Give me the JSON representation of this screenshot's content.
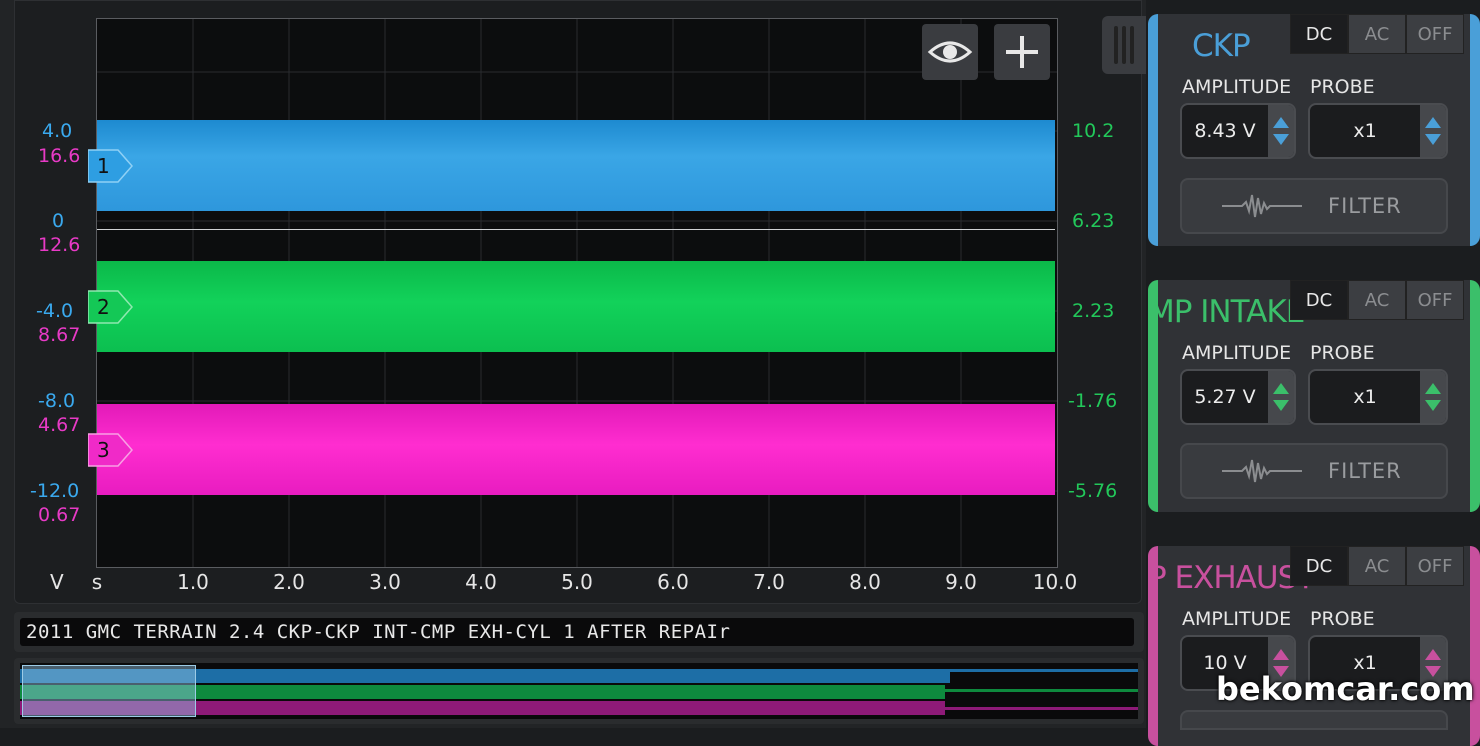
{
  "left_axis": {
    "unit": "V",
    "ticks": [
      {
        "blue": "4.0",
        "pink": "16.6"
      },
      {
        "blue": "0",
        "pink": "12.6"
      },
      {
        "blue": "-4.0",
        "pink": "8.67"
      },
      {
        "blue": "-8.0",
        "pink": "4.67"
      },
      {
        "blue": "-12.0",
        "pink": "0.67"
      }
    ]
  },
  "right_axis": {
    "ticks": [
      "10.2",
      "6.23",
      "2.23",
      "-1.76",
      "-5.76"
    ]
  },
  "x_axis": {
    "unit": "s",
    "ticks": [
      "1.0",
      "2.0",
      "3.0",
      "4.0",
      "5.0",
      "6.0",
      "7.0",
      "8.0",
      "9.0",
      "10.0"
    ]
  },
  "channels": [
    {
      "marker": "1",
      "color": "#2e97dc"
    },
    {
      "marker": "2",
      "color": "#12d25a"
    },
    {
      "marker": "3",
      "color": "#f021c6"
    }
  ],
  "toolbar": {
    "eye_icon": "eye-icon",
    "add_icon": "plus-icon"
  },
  "caption": "2011 GMC TERRAIN 2.4 CKP-CKP INT-CMP EXH-CYL 1 AFTER REPAIr",
  "panels": [
    {
      "name": "CKP",
      "accent": "#4a9fd8",
      "modes": [
        "DC",
        "AC",
        "OFF"
      ],
      "active_mode": "DC",
      "amplitude_label": "AMPLITUDE",
      "probe_label": "PROBE",
      "amplitude": "8.43 V",
      "probe": "x1",
      "filter": "FILTER"
    },
    {
      "name": "MP INTAKE",
      "accent": "#3bbf6a",
      "modes": [
        "DC",
        "AC",
        "OFF"
      ],
      "active_mode": "DC",
      "amplitude_label": "AMPLITUDE",
      "probe_label": "PROBE",
      "amplitude": "5.27 V",
      "probe": "x1",
      "filter": "FILTER"
    },
    {
      "name": "P EXHAUST",
      "accent": "#c8509e",
      "modes": [
        "DC",
        "AC",
        "OFF"
      ],
      "active_mode": "DC",
      "amplitude_label": "AMPLITUDE",
      "probe_label": "PROBE",
      "amplitude": "10 V",
      "probe": "x1"
    }
  ],
  "watermark": "bekomcar.com"
}
